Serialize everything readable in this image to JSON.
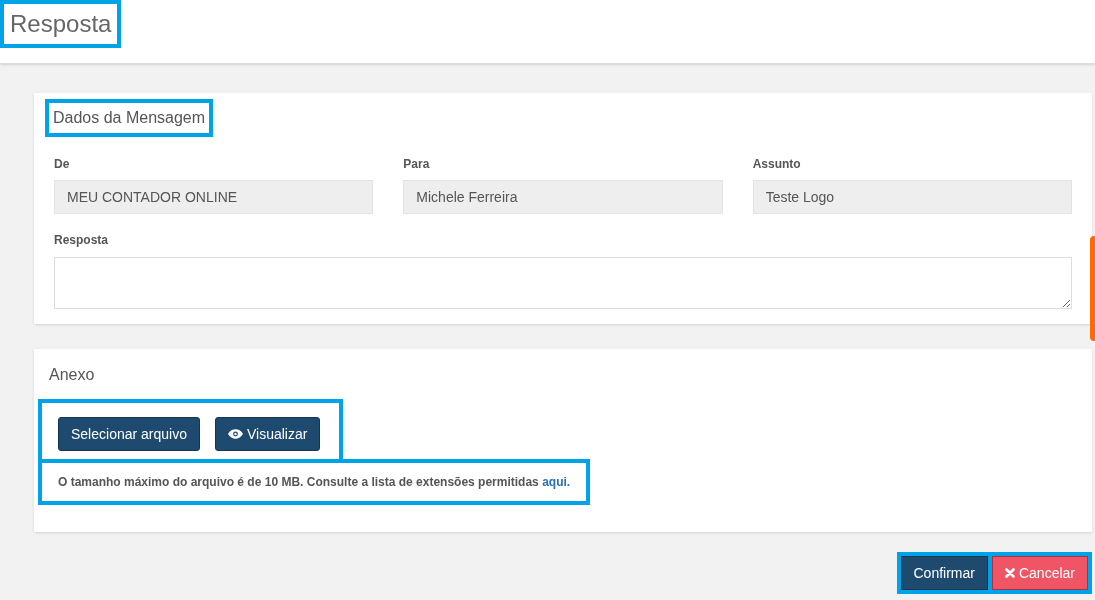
{
  "page_title": {
    "text": "Resposta",
    "highlighted": true
  },
  "message_card": {
    "title": {
      "text": "Dados da Mensagem",
      "highlighted": true
    },
    "fields": [
      {
        "label": "De",
        "value": "MEU CONTADOR ONLINE",
        "disabled": true
      },
      {
        "label": "Para",
        "value": "Michele Ferreira",
        "disabled": true
      },
      {
        "label": "Assunto",
        "value": "Teste Logo",
        "disabled": true
      }
    ],
    "reply": {
      "label": "Resposta"
    }
  },
  "attachment_card": {
    "title": "Anexo",
    "buttons_highlighted": true,
    "buttons": [
      {
        "label": "Selecionar arquivo",
        "kind": "select"
      },
      {
        "label": "Visualizar",
        "kind": "preview"
      }
    ],
    "note": {
      "text": "O tamanho máximo do arquivo é de 10 MB. Consulte a lista de extensões permitidas",
      "link": "aqui.",
      "highlighted": true
    }
  },
  "actions_highlighted": true,
  "actions": [
    {
      "label": "Confirmar",
      "kind": "primary"
    },
    {
      "label": "Cancelar",
      "kind": "danger"
    }
  ]
}
